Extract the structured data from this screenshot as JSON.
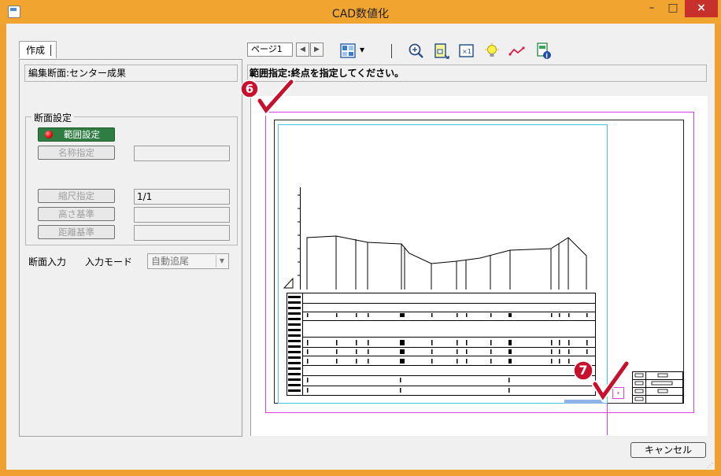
{
  "window": {
    "title": "CAD数値化",
    "close_symbol": "×",
    "minimize_symbol": "–",
    "maximize_symbol": "□"
  },
  "left_tab": {
    "label": "作成"
  },
  "edit_section": {
    "text": "編集断面:センター成果"
  },
  "section_settings": {
    "group_label": "断面設定",
    "range_button": "範囲設定",
    "name_button": "名称指定",
    "scale_button": "縮尺指定",
    "scale_value": "1/1",
    "height_button": "高さ基準",
    "distance_button": "距離基準"
  },
  "input_row": {
    "section_input_label": "断面入力",
    "input_mode_label": "入力モード",
    "mode_value": "自動追尾",
    "mode_arrow": "▼"
  },
  "toolbar": {
    "page_label": "ページ1",
    "prev_symbol": "◀",
    "next_symbol": "▶",
    "dropdown_symbol": "▾"
  },
  "message": {
    "text": "範囲指定:終点を指定してください。"
  },
  "markers": {
    "step6": "6",
    "step7": "7"
  },
  "cancel_button": {
    "label": "キャンセル"
  },
  "grip_symbol": "⋰",
  "colors": {
    "title_bar": "#f2a431",
    "close": "#c7302b",
    "active_button": "#2f7d43",
    "magenta_frame": "#e040e0",
    "cyan_frame": "#40c8e0",
    "marker_red": "#c8102e"
  }
}
